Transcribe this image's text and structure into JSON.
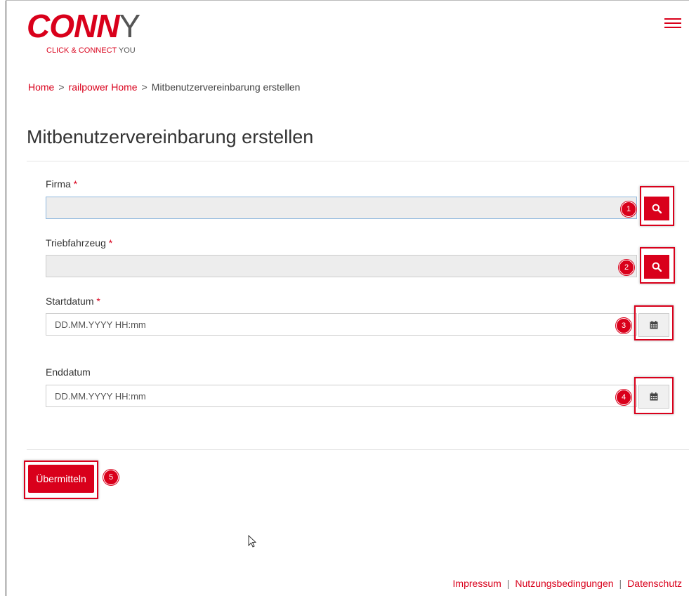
{
  "brand": {
    "logo_red": "CONN",
    "logo_gray": "Y",
    "tagline_red": "CLICK & CONNECT",
    "tagline_gray": "YOU",
    "accent_color": "#d9001b"
  },
  "breadcrumb": {
    "home": "Home",
    "sep1": ">",
    "parent": "railpower Home",
    "sep2": ">",
    "current": "Mitbenutzervereinbarung erstellen"
  },
  "page_title": "Mitbenutzervereinbarung erstellen",
  "form": {
    "firma": {
      "label": "Firma",
      "required": "*",
      "value": "",
      "badge": "1",
      "button_icon": "search-icon"
    },
    "triebfahrzeug": {
      "label": "Triebfahrzeug",
      "required": "*",
      "value": "",
      "badge": "2",
      "button_icon": "search-icon"
    },
    "startdatum": {
      "label": "Startdatum",
      "required": "*",
      "placeholder": "DD.MM.YYYY HH:mm",
      "badge": "3",
      "button_icon": "calendar-icon"
    },
    "enddatum": {
      "label": "Enddatum",
      "placeholder": "DD.MM.YYYY HH:mm",
      "badge": "4",
      "button_icon": "calendar-icon"
    }
  },
  "submit": {
    "label": "Übermitteln",
    "badge": "5"
  },
  "footer": {
    "impressum": "Impressum",
    "nutzungsbedingungen": "Nutzungsbedingungen",
    "datenschutz": "Datenschutz"
  }
}
